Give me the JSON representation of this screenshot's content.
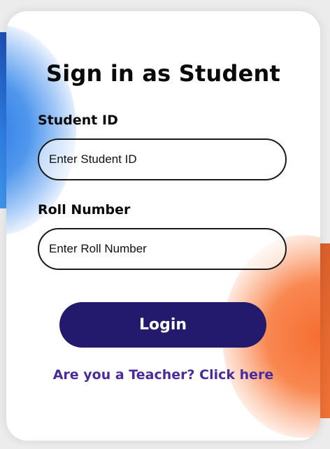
{
  "header": {
    "title": "Sign in as Student"
  },
  "form": {
    "student_id_label": "Student ID",
    "student_id_placeholder": "Enter Student ID",
    "roll_label": "Roll Number",
    "roll_placeholder": "Enter Roll Number",
    "login_label": "Login"
  },
  "footer": {
    "teacher_link": "Are you a Teacher? Click here"
  },
  "colors": {
    "button_bg": "#231a6e",
    "link": "#4a2a9c",
    "blob_blue": "#2f78e6",
    "blob_orange": "#f56e32"
  }
}
